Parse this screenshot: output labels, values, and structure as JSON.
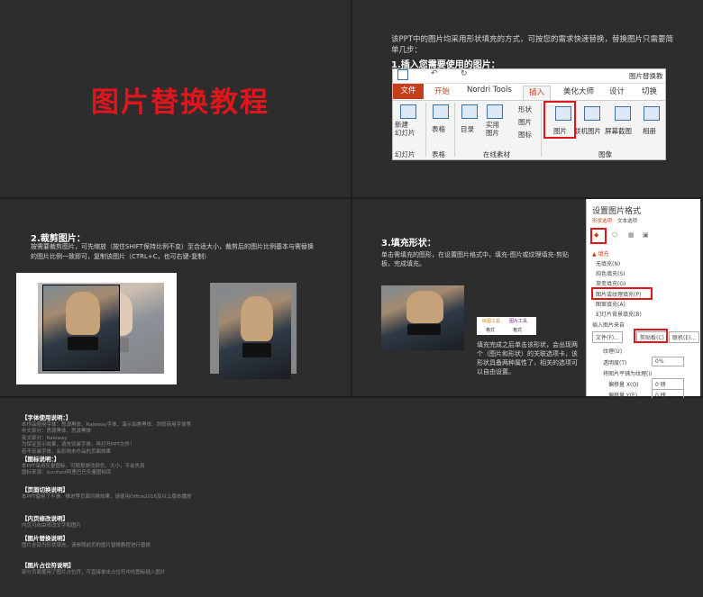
{
  "slide1": {
    "title": "图片替换教程"
  },
  "slide2": {
    "intro": "该PPT中的图片均采用形状填充的方式，可按您的需求快速替换，替换图片只需要简单几步：",
    "heading": "1.插入您需要使用的图片：",
    "ribbon": {
      "window_title": "图片替换教",
      "tabs": [
        "文件",
        "开始",
        "Nordri Tools",
        "插入",
        "美化大师",
        "设计",
        "切换"
      ],
      "groups": {
        "new_slide": "新建\n幻灯片",
        "new_slide_short": "幻灯片",
        "table": "表格",
        "table_group": "表格",
        "toc": "目录",
        "material": "实用\n图片",
        "shape": "形状",
        "image": "图片",
        "icon": "图标",
        "online_material": "在线素材",
        "picture": "图片",
        "online_picture": "联机图片",
        "screenshot": "屏幕截图",
        "album": "相册",
        "image_group": "图像"
      }
    }
  },
  "slide3": {
    "heading": "2.裁剪图片：",
    "intro": "按需要裁剪图片，可先缩放（按住SHIFT保持比例不变）至合适大小，裁剪后的图片比例基本与需替换的图片比例一致即可，复制该图片（CTRL+C，也可右键-复制）"
  },
  "slide4": {
    "heading": "3.填充形状：",
    "intro": "单击需填充的图形，在设置图片格式中，填充-图片或纹理填充-剪贴板，完成填充。",
    "note": "填充完成之后单击该形状，会出现两个（图片和形状）的关联选项卡，该形状具备两种属性了，相关的选项可以自由设置。",
    "mini_tabs": [
      "绘图工具",
      "图片工具",
      "格式",
      "格式"
    ],
    "pane": {
      "title": "设置图片格式",
      "tab1": "形状选项",
      "tab2": "文本选项",
      "section": "▲ 填充",
      "options": [
        "无填充(N)",
        "纯色填充(S)",
        "渐变填充(G)",
        "图片或纹理填充(P)",
        "图案填充(A)",
        "幻灯片背景填充(B)"
      ],
      "insert_from": "插入图片来自",
      "btn_file": "文件(F)...",
      "btn_clip": "剪贴板(C)",
      "btn_online": "联机(E)...",
      "texture": "纹理(U)",
      "transparency": "透明度(T)",
      "transparency_val": "0%",
      "tile": "将图片平铺为纹理(I)",
      "offset_x": "偏移量 X(O)",
      "offset_x_val": "0 磅",
      "offset_y": "偏移量 Y(E)",
      "offset_y_val": "0 磅"
    }
  },
  "slide5": {
    "sections": [
      {
        "heading": "【字体使用说明：】",
        "lines": [
          "本作品使用字体：思源黑体、Raleway字体、演示如美黑体、剑雨商用字体等",
          "中文部分：思源黑体、思源黑体",
          "英文部分：Raleway",
          "为保证显示效果，请先安装字体，再打开PPT文件！",
          "若不安装字体，会影响本作品的页面效果"
        ]
      },
      {
        "heading": "【图标说明：】",
        "lines": [
          "本PPT采用矢量图标，可随意更改颜色、大小，不会失真",
          "图标来源：iconfont阿里巴巴矢量图标库"
        ]
      },
      {
        "heading": "【页面切换说明】",
        "lines": [
          "本PPT使用了平滑、推进等页面切换效果，请使用Office2016及以上版本播放"
        ]
      },
      {
        "heading": "【内页修改说明】",
        "lines": [
          "内页可自由修改文字和图片"
        ]
      },
      {
        "heading": "【图片替换说明】",
        "lines": [
          "图片全部为形状填充，请参照前页的图片替换教程进行替换"
        ]
      },
      {
        "heading": "【图片占位符说明】",
        "lines": [
          "部分页面使用了图片占位符，可直接单击占位符中的图标插入图片"
        ]
      }
    ]
  }
}
